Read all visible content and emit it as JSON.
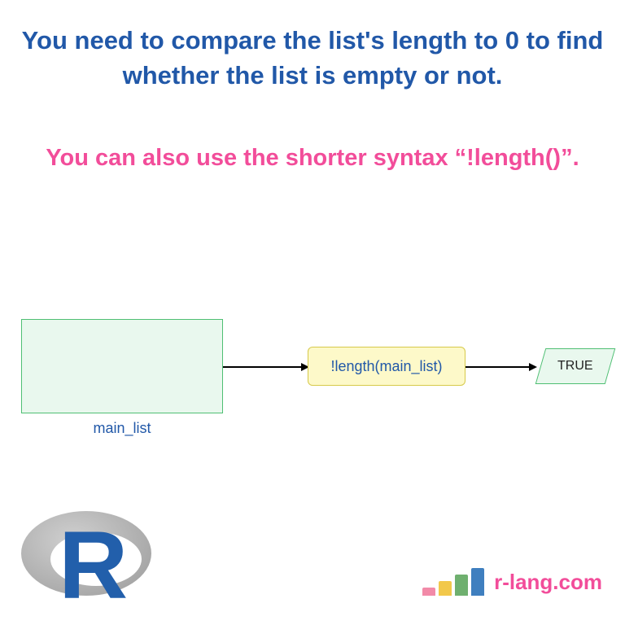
{
  "headline": "You need to compare the list's length to 0 to find whether the list is empty or not.",
  "subhead": "You can also use the shorter syntax “!length()”.",
  "diagram": {
    "list_box_label": "main_list",
    "func_box_label": "!length(main_list)",
    "result_label": "TRUE"
  },
  "logo_letter": "R",
  "brand": "r-lang.com"
}
